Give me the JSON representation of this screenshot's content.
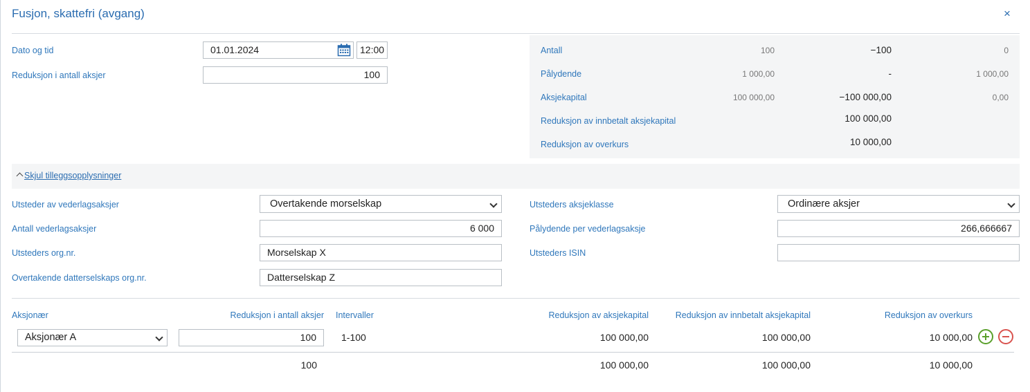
{
  "dialog": {
    "title": "Fusjon, skattefri (avgang)",
    "close_icon": "×"
  },
  "form": {
    "date_label": "Dato og tid",
    "date_value": "01.01.2024",
    "time_value": "12:00",
    "reduction_label": "Reduksjon i antall aksjer",
    "reduction_value": "100"
  },
  "summary": {
    "rows": [
      {
        "label": "Antall",
        "before": "100",
        "change": "−100",
        "after": "0"
      },
      {
        "label": "Pålydende",
        "before": "1 000,00",
        "change": "-",
        "after": "1 000,00"
      },
      {
        "label": "Aksjekapital",
        "before": "100 000,00",
        "change": "−100 000,00",
        "after": "0,00"
      },
      {
        "label": "Reduksjon av innbetalt aksjekapital",
        "before": "",
        "change": "100 000,00",
        "after": ""
      },
      {
        "label": "Reduksjon av overkurs",
        "before": "",
        "change": "10 000,00",
        "after": ""
      }
    ]
  },
  "extra": {
    "toggle_label": "Skjul tilleggsopplysninger",
    "issuer_label": "Utsteder av vederlagsaksjer",
    "issuer_value": "Overtakende morselskap",
    "count_label": "Antall vederlagsaksjer",
    "count_value": "6 000",
    "orgnr_label": "Utsteders org.nr.",
    "orgnr_value": "Morselskap X",
    "daughter_label": "Overtakende datterselskaps org.nr.",
    "daughter_value": "Datterselskap Z",
    "class_label": "Utsteders aksjeklasse",
    "class_value": "Ordinære aksjer",
    "nominal_label": "Pålydende per vederlagsaksje",
    "nominal_value": "266,666667",
    "isin_label": "Utsteders ISIN",
    "isin_value": ""
  },
  "table": {
    "headers": {
      "shareholder": "Aksjonær",
      "reduction": "Reduksjon i antall aksjer",
      "intervals": "Intervaller",
      "capital": "Reduksjon av aksjekapital",
      "paid_in": "Reduksjon av innbetalt aksjekapital",
      "premium": "Reduksjon av overkurs"
    },
    "row": {
      "shareholder": "Aksjonær A",
      "reduction": "100",
      "intervals": "1-100",
      "capital": "100 000,00",
      "paid_in": "100 000,00",
      "premium": "10 000,00"
    },
    "totals": {
      "reduction": "100",
      "capital": "100 000,00",
      "paid_in": "100 000,00",
      "premium": "10 000,00"
    }
  },
  "colors": {
    "accent": "#2a6cb0",
    "add": "#5aa02c",
    "remove": "#d9534f"
  }
}
